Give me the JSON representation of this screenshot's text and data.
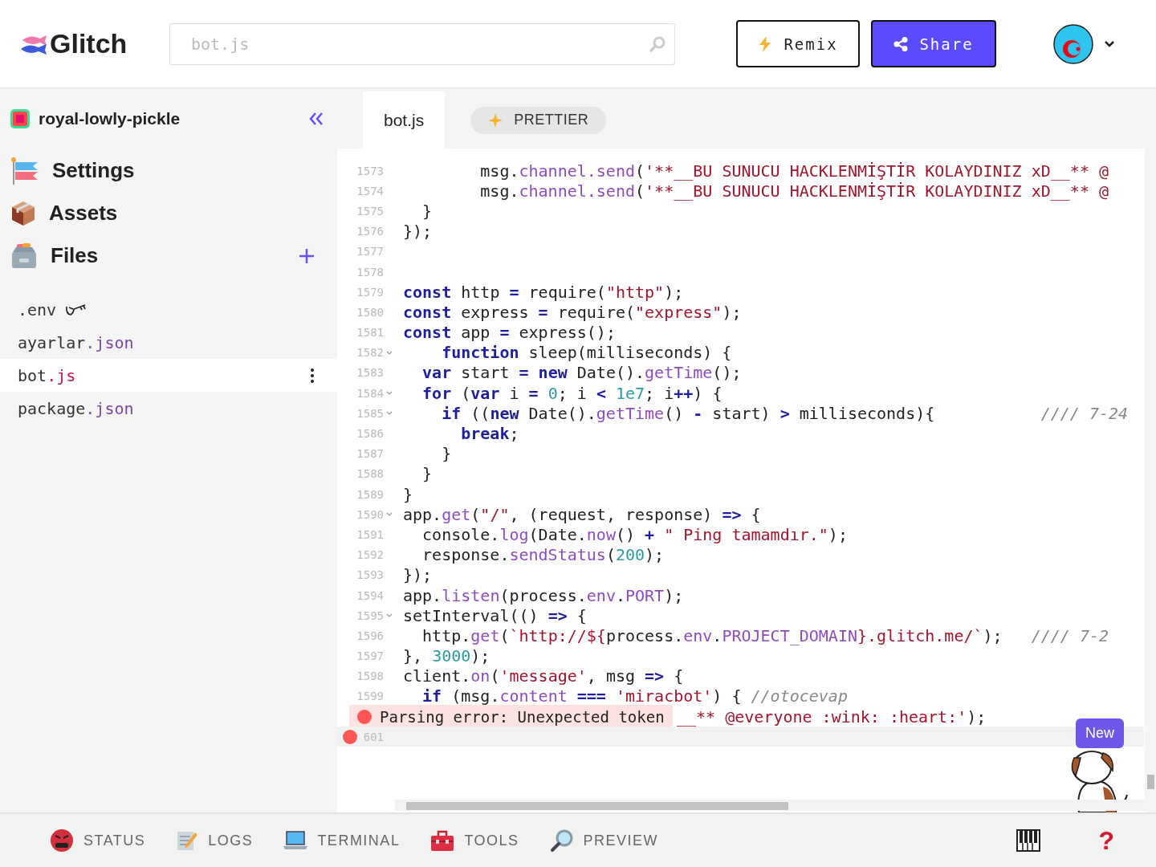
{
  "header": {
    "logo": "Glitch",
    "search": {
      "placeholder": "bot.js"
    },
    "remix_button": "Remix",
    "share_button": "Share"
  },
  "sidebar": {
    "project_name": "royal-lowly-pickle",
    "nav": [
      {
        "kind": "settings",
        "label": "Settings"
      },
      {
        "kind": "assets",
        "label": "Assets"
      },
      {
        "kind": "files",
        "label": "Files"
      }
    ],
    "files": [
      {
        "name": ".env",
        "kind": "env",
        "selected": false
      },
      {
        "name": "ayarlar",
        "ext": ".json",
        "color": "#7b45a8",
        "selected": false
      },
      {
        "name": "bot",
        "ext": ".js",
        "color": "#c2185b",
        "selected": true
      },
      {
        "name": "package",
        "ext": ".json",
        "color": "#7b45a8",
        "selected": false
      }
    ]
  },
  "editor": {
    "tabs": [
      {
        "label": "bot.js",
        "selected": true
      }
    ],
    "prettier_button": "PRETTIER",
    "lines": [
      {
        "number": "1573",
        "fold": false,
        "tokens": [
          {
            "kind": "plain",
            "text": "        msg."
          },
          {
            "kind": "prop",
            "text": "channel.send"
          },
          {
            "kind": "plain",
            "text": "("
          },
          {
            "kind": "str",
            "text": "'**__BU SUNUCU HACKLENMİŞTİR KOLAYDINIZ xD__** @"
          }
        ]
      },
      {
        "number": "1574",
        "fold": false,
        "tokens": [
          {
            "kind": "plain",
            "text": "        msg."
          },
          {
            "kind": "prop",
            "text": "channel.send"
          },
          {
            "kind": "plain",
            "text": "("
          },
          {
            "kind": "str",
            "text": "'**__BU SUNUCU HACKLENMİŞTİR KOLAYDINIZ xD__** @"
          }
        ]
      },
      {
        "number": "1575",
        "fold": false,
        "tokens": [
          {
            "kind": "plain",
            "text": "  }"
          }
        ]
      },
      {
        "number": "1576",
        "fold": false,
        "tokens": [
          {
            "kind": "plain",
            "text": "});"
          }
        ]
      },
      {
        "number": "1577",
        "fold": false
      },
      {
        "number": "1578",
        "fold": false
      },
      {
        "number": "1579",
        "fold": false,
        "tokens": [
          {
            "kind": "kw",
            "text": "const"
          },
          {
            "kind": "plain",
            "text": " http "
          },
          {
            "kind": "op",
            "text": "="
          },
          {
            "kind": "plain",
            "text": " require("
          },
          {
            "kind": "str",
            "text": "\"http\""
          },
          {
            "kind": "plain",
            "text": ");"
          }
        ]
      },
      {
        "number": "1580",
        "fold": false,
        "tokens": [
          {
            "kind": "kw",
            "text": "const"
          },
          {
            "kind": "plain",
            "text": " express "
          },
          {
            "kind": "op",
            "text": "="
          },
          {
            "kind": "plain",
            "text": " require("
          },
          {
            "kind": "str",
            "text": "\"express\""
          },
          {
            "kind": "plain",
            "text": ");"
          }
        ]
      },
      {
        "number": "1581",
        "fold": false,
        "tokens": [
          {
            "kind": "kw",
            "text": "const"
          },
          {
            "kind": "plain",
            "text": " app "
          },
          {
            "kind": "op",
            "text": "="
          },
          {
            "kind": "plain",
            "text": " express();"
          }
        ]
      },
      {
        "number": "1582",
        "fold": true,
        "tokens": [
          {
            "kind": "kw",
            "text": "    function"
          },
          {
            "kind": "plain",
            "text": " sleep(milliseconds) {"
          }
        ]
      },
      {
        "number": "1583",
        "fold": false,
        "tokens": [
          {
            "kind": "kw",
            "text": "  var"
          },
          {
            "kind": "plain",
            "text": " start "
          },
          {
            "kind": "op",
            "text": "="
          },
          {
            "kind": "kw",
            "text": " new"
          },
          {
            "kind": "plain",
            "text": " Date()."
          },
          {
            "kind": "prop",
            "text": "getTime"
          },
          {
            "kind": "plain",
            "text": "();"
          }
        ]
      },
      {
        "number": "1584",
        "fold": true,
        "tokens": [
          {
            "kind": "kw",
            "text": "  for"
          },
          {
            "kind": "plain",
            "text": " ("
          },
          {
            "kind": "kw",
            "text": "var"
          },
          {
            "kind": "plain",
            "text": " i "
          },
          {
            "kind": "op",
            "text": "="
          },
          {
            "kind": "num",
            "text": " 0"
          },
          {
            "kind": "plain",
            "text": "; i "
          },
          {
            "kind": "op",
            "text": "<"
          },
          {
            "kind": "num",
            "text": " 1e7"
          },
          {
            "kind": "plain",
            "text": "; i"
          },
          {
            "kind": "op",
            "text": "++"
          },
          {
            "kind": "plain",
            "text": ") {"
          }
        ]
      },
      {
        "number": "1585",
        "fold": true,
        "tokens": [
          {
            "kind": "kw",
            "text": "    if"
          },
          {
            "kind": "plain",
            "text": " (("
          },
          {
            "kind": "kw",
            "text": "new"
          },
          {
            "kind": "plain",
            "text": " Date()."
          },
          {
            "kind": "prop",
            "text": "getTime"
          },
          {
            "kind": "plain",
            "text": "() "
          },
          {
            "kind": "op",
            "text": "-"
          },
          {
            "kind": "plain",
            "text": " start) "
          },
          {
            "kind": "op",
            "text": ">"
          },
          {
            "kind": "plain",
            "text": " milliseconds){           "
          },
          {
            "kind": "cm",
            "text": "//// 7-24"
          }
        ]
      },
      {
        "number": "1586",
        "fold": false,
        "tokens": [
          {
            "kind": "kw",
            "text": "      break"
          },
          {
            "kind": "plain",
            "text": ";"
          }
        ]
      },
      {
        "number": "1587",
        "fold": false,
        "tokens": [
          {
            "kind": "plain",
            "text": "    }"
          }
        ]
      },
      {
        "number": "1588",
        "fold": false,
        "tokens": [
          {
            "kind": "plain",
            "text": "  }"
          }
        ]
      },
      {
        "number": "1589",
        "fold": false,
        "tokens": [
          {
            "kind": "plain",
            "text": "}"
          }
        ]
      },
      {
        "number": "1590",
        "fold": true,
        "tokens": [
          {
            "kind": "plain",
            "text": "app."
          },
          {
            "kind": "prop",
            "text": "get"
          },
          {
            "kind": "plain",
            "text": "("
          },
          {
            "kind": "str",
            "text": "\"/\""
          },
          {
            "kind": "plain",
            "text": ", (request, response) "
          },
          {
            "kind": "op",
            "text": "=>"
          },
          {
            "kind": "plain",
            "text": " {"
          }
        ]
      },
      {
        "number": "1591",
        "fold": false,
        "tokens": [
          {
            "kind": "plain",
            "text": "  console."
          },
          {
            "kind": "prop",
            "text": "log"
          },
          {
            "kind": "plain",
            "text": "(Date."
          },
          {
            "kind": "prop",
            "text": "now"
          },
          {
            "kind": "plain",
            "text": "() "
          },
          {
            "kind": "op",
            "text": "+"
          },
          {
            "kind": "str",
            "text": " \" Ping tamamdır.\""
          },
          {
            "kind": "plain",
            "text": ");"
          }
        ]
      },
      {
        "number": "1592",
        "fold": false,
        "tokens": [
          {
            "kind": "plain",
            "text": "  response."
          },
          {
            "kind": "prop",
            "text": "sendStatus"
          },
          {
            "kind": "plain",
            "text": "("
          },
          {
            "kind": "num",
            "text": "200"
          },
          {
            "kind": "plain",
            "text": ");"
          }
        ]
      },
      {
        "number": "1593",
        "fold": false,
        "tokens": [
          {
            "kind": "plain",
            "text": "});"
          }
        ]
      },
      {
        "number": "1594",
        "fold": false,
        "tokens": [
          {
            "kind": "plain",
            "text": "app."
          },
          {
            "kind": "prop",
            "text": "listen"
          },
          {
            "kind": "plain",
            "text": "(process."
          },
          {
            "kind": "prop",
            "text": "env"
          },
          {
            "kind": "plain",
            "text": "."
          },
          {
            "kind": "prop",
            "text": "PORT"
          },
          {
            "kind": "plain",
            "text": ");"
          }
        ]
      },
      {
        "number": "1595",
        "fold": true,
        "tokens": [
          {
            "kind": "plain",
            "text": "setInterval(() "
          },
          {
            "kind": "op",
            "text": "=>"
          },
          {
            "kind": "plain",
            "text": " {"
          }
        ]
      },
      {
        "number": "1596",
        "fold": false,
        "tokens": [
          {
            "kind": "plain",
            "text": "  http."
          },
          {
            "kind": "prop",
            "text": "get"
          },
          {
            "kind": "plain",
            "text": "("
          },
          {
            "kind": "str",
            "text": "`http://${"
          },
          {
            "kind": "plain",
            "text": "process."
          },
          {
            "kind": "prop",
            "text": "env"
          },
          {
            "kind": "plain",
            "text": "."
          },
          {
            "kind": "prop",
            "text": "PROJECT_DOMAIN"
          },
          {
            "kind": "str",
            "text": "}.glitch.me/`"
          },
          {
            "kind": "plain",
            "text": ");   "
          },
          {
            "kind": "cm",
            "text": "//// 7-2"
          }
        ]
      },
      {
        "number": "1597",
        "fold": false,
        "tokens": [
          {
            "kind": "plain",
            "text": "}, "
          },
          {
            "kind": "num",
            "text": "3000"
          },
          {
            "kind": "plain",
            "text": ");"
          }
        ]
      },
      {
        "number": "1598",
        "fold": false,
        "tokens": [
          {
            "kind": "plain",
            "text": "client."
          },
          {
            "kind": "prop",
            "text": "on"
          },
          {
            "kind": "plain",
            "text": "("
          },
          {
            "kind": "str",
            "text": "'message'"
          },
          {
            "kind": "plain",
            "text": ", msg "
          },
          {
            "kind": "op",
            "text": "=>"
          },
          {
            "kind": "plain",
            "text": " {"
          }
        ]
      },
      {
        "number": "1599",
        "fold": false,
        "tokens": [
          {
            "kind": "kw",
            "text": "  if"
          },
          {
            "kind": "plain",
            "text": " (msg."
          },
          {
            "kind": "prop",
            "text": "content"
          },
          {
            "kind": "op",
            "text": " ==="
          },
          {
            "kind": "str",
            "text": " 'miracbot'"
          },
          {
            "kind": "plain",
            "text": ") { "
          },
          {
            "kind": "cm",
            "text": "//otocevap"
          }
        ]
      },
      {
        "fold": false,
        "error_tooltip": "Parsing error: Unexpected token",
        "tokens": [
          {
            "kind": "str",
            "text": "__** @everyone :wink: :heart:'"
          },
          {
            "kind": "plain",
            "text": ");"
          }
        ]
      },
      {
        "number": "601",
        "fold": false,
        "active": true,
        "error": true
      }
    ],
    "new_badge": "New"
  },
  "bottom_bar": {
    "items": [
      {
        "kind": "status",
        "label": "STATUS"
      },
      {
        "kind": "logs",
        "label": "LOGS"
      },
      {
        "kind": "terminal",
        "label": "TERMINAL"
      },
      {
        "kind": "tools",
        "label": "TOOLS"
      },
      {
        "kind": "preview",
        "label": "PREVIEW"
      }
    ],
    "help": "?"
  }
}
